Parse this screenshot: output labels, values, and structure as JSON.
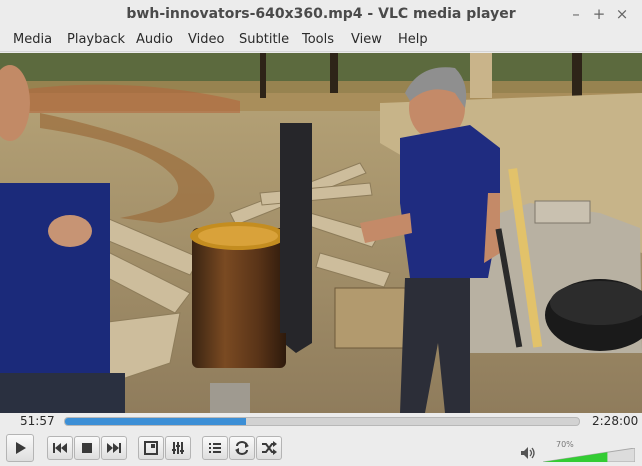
{
  "window": {
    "title": "bwh-innovators-640x360.mp4 - VLC media player",
    "controls": [
      "minimize-icon",
      "maximize-icon",
      "close-icon"
    ]
  },
  "menu": {
    "items": [
      {
        "label": "Media",
        "underline": "M"
      },
      {
        "label": "Playback",
        "underline": "l"
      },
      {
        "label": "Audio",
        "underline": "A"
      },
      {
        "label": "Video",
        "underline": "V"
      },
      {
        "label": "Subtitle",
        "underline": "t"
      },
      {
        "label": "Tools",
        "underline": "s"
      },
      {
        "label": "View",
        "underline": "i"
      },
      {
        "label": "Help",
        "underline": "H"
      }
    ]
  },
  "playback": {
    "elapsed": "51:57",
    "total": "2:28:00",
    "progress": 0.353
  },
  "controls": {
    "buttons": [
      "play-icon",
      "previous-icon",
      "stop-icon",
      "next-icon",
      "fullscreen-icon",
      "extended-settings-icon",
      "playlist-icon",
      "loop-icon",
      "shuffle-icon"
    ]
  },
  "volume": {
    "label": "70%",
    "level": 0.7,
    "icon": "speaker-icon"
  },
  "colors": {
    "accent": "#3c8fd6",
    "volume_fill": "#33cc33"
  }
}
